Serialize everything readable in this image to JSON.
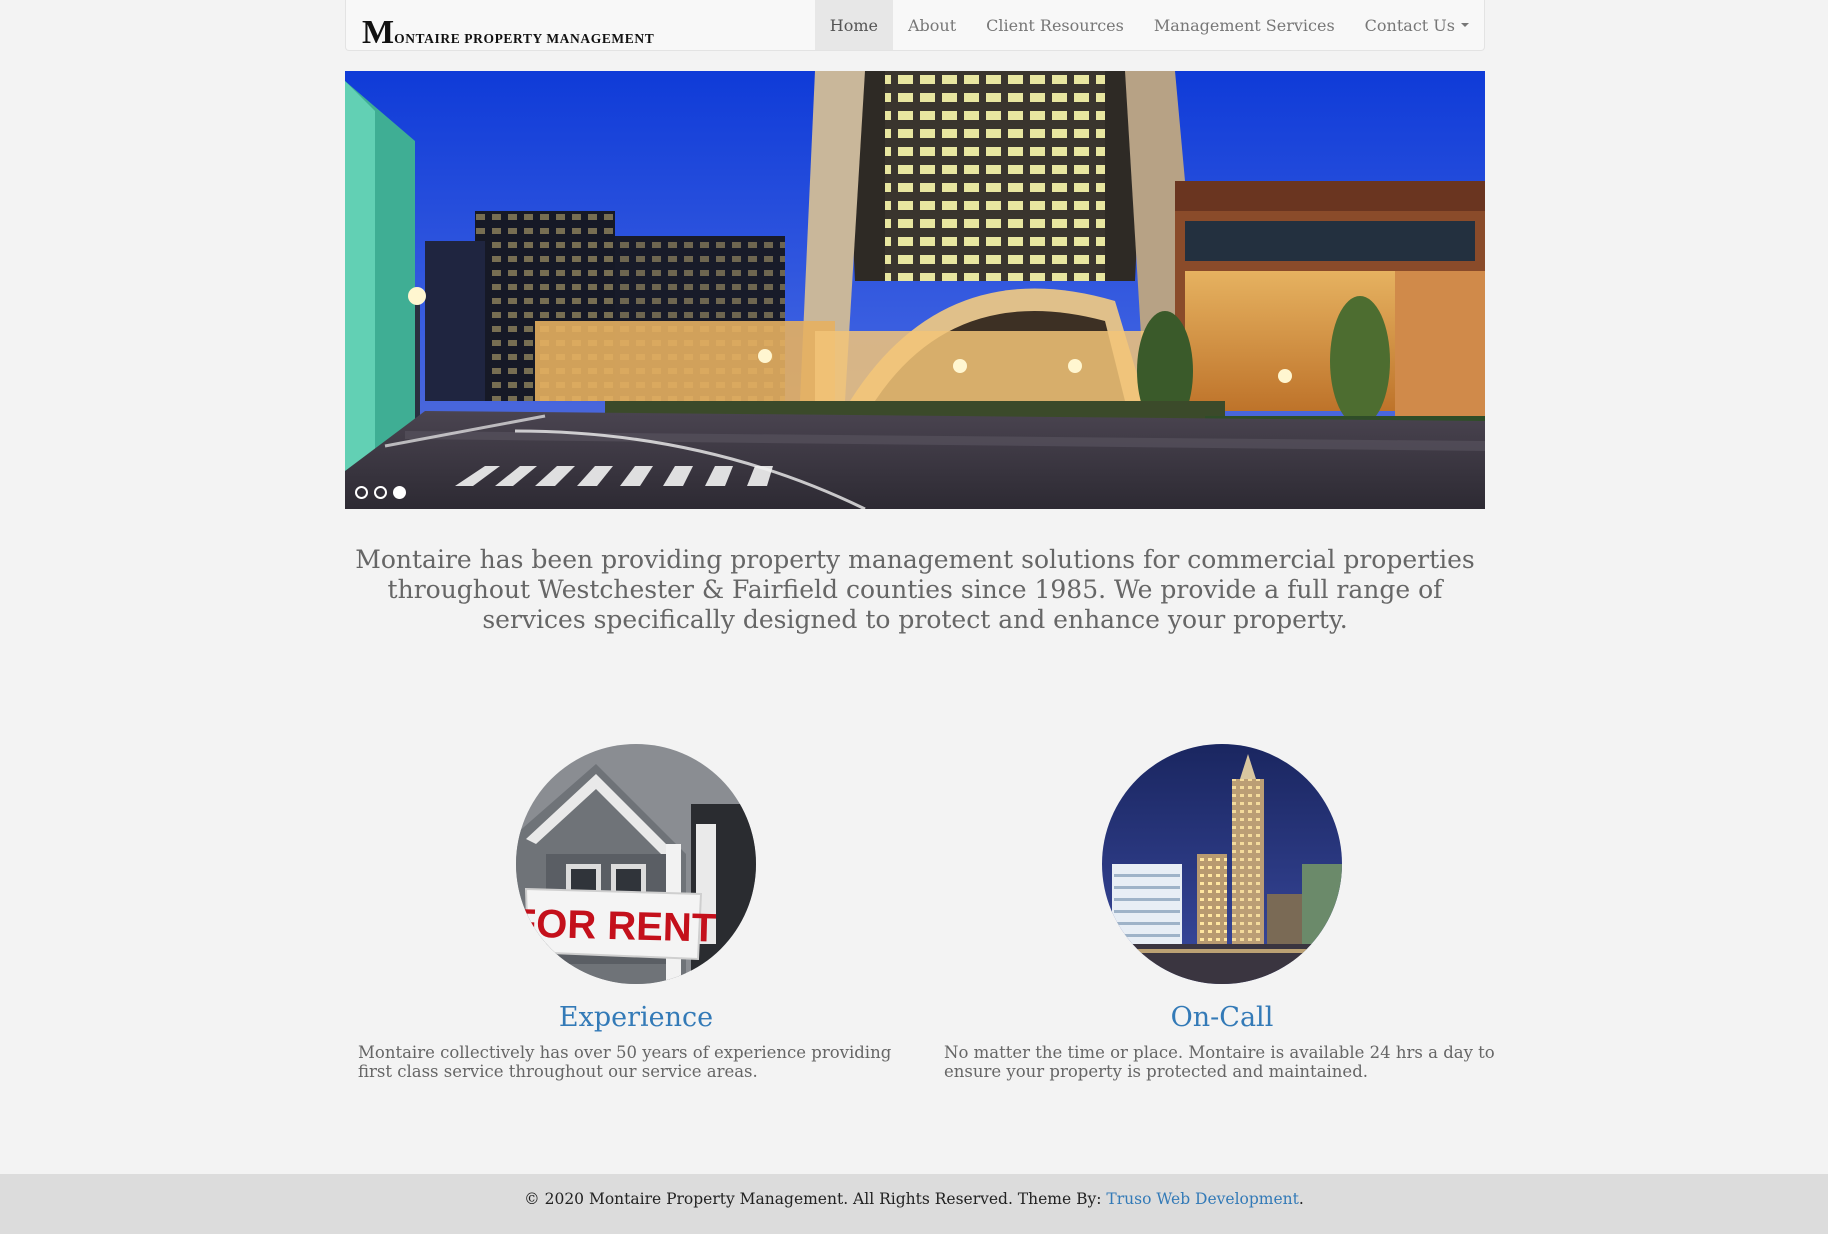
{
  "brand": {
    "initial": "M",
    "rest": "ONTAIRE PROPERTY MANAGEMENT"
  },
  "nav": {
    "items": [
      {
        "label": "Home",
        "active": true
      },
      {
        "label": "About"
      },
      {
        "label": "Client Resources"
      },
      {
        "label": "Management Services"
      },
      {
        "label": "Contact Us",
        "dropdown": true
      }
    ]
  },
  "carousel": {
    "slide_count": 3,
    "active_index": 2
  },
  "intro": {
    "text": "Montaire has been providing property management solutions for commercial properties throughout Westchester & Fairfield counties since 1985. We provide a full range of services specifically designed to protect and enhance your property."
  },
  "features": [
    {
      "image_sign": "FOR RENT",
      "title": "Experience",
      "text": "Montaire collectively has over 50 years of experience providing first class service throughout our service areas."
    },
    {
      "title": "On-Call",
      "text": "No matter the time or place. Montaire is available 24 hrs a day to ensure your property is protected and maintained."
    }
  ],
  "footer": {
    "text": "© 2020 Montaire Property Management. All Rights Reserved. Theme By: ",
    "link_label": "Truso Web Development",
    "suffix": "."
  },
  "colors": {
    "link": "#337ab7",
    "footer_bg": "#dcdcdc",
    "page_bg": "#f3f3f3"
  }
}
